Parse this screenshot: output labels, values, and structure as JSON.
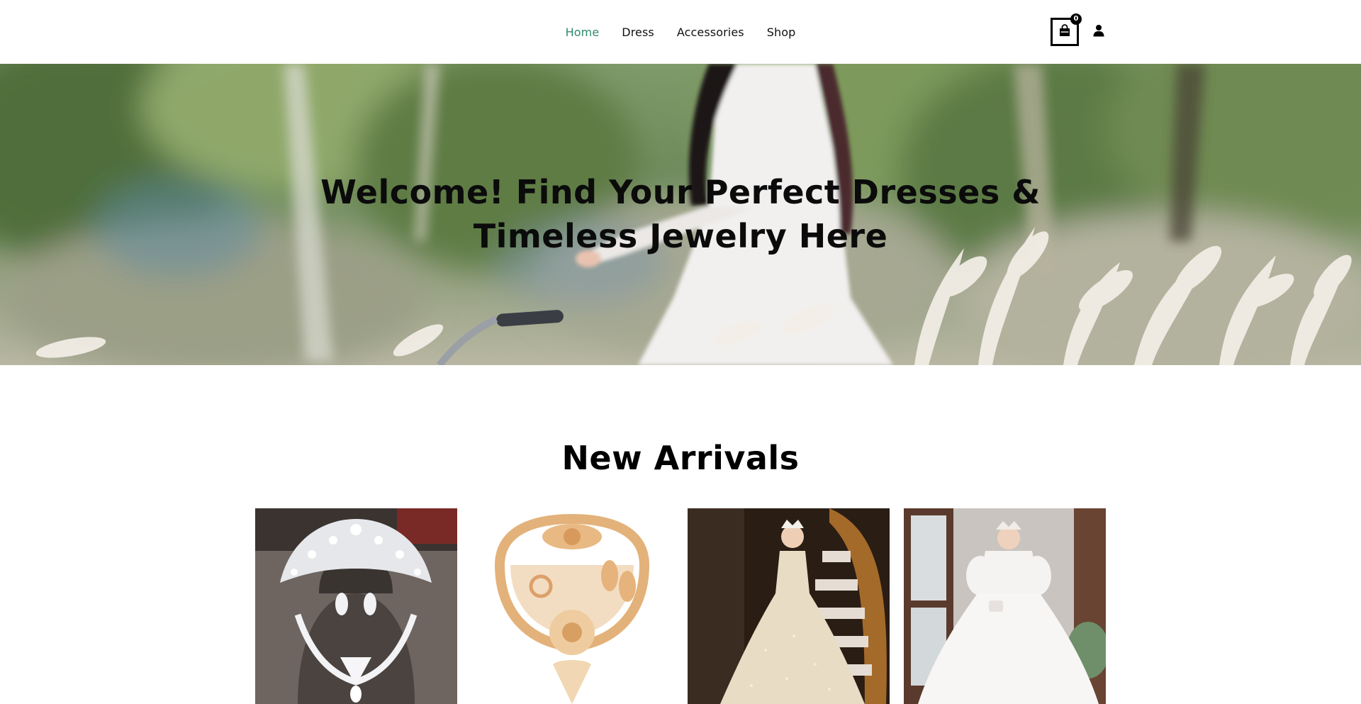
{
  "nav": {
    "items": [
      {
        "label": "Home",
        "active": true
      },
      {
        "label": "Dress",
        "active": false
      },
      {
        "label": "Accessories",
        "active": false
      },
      {
        "label": "Shop",
        "active": false
      }
    ],
    "cart": {
      "icon": "shopping-bag-icon",
      "count": "0"
    },
    "account": {
      "icon": "user-icon"
    }
  },
  "hero": {
    "title": "Welcome! Find Your Perfect Dresses & Timeless Jewelry Here"
  },
  "new_arrivals": {
    "title": "New Arrivals",
    "products": [
      {
        "image": "silver-crystal-tiara-jewelry-set"
      },
      {
        "image": "gold-flower-jewelry-set"
      },
      {
        "image": "champagne-sequin-girls-gown"
      },
      {
        "image": "white-tulle-girls-gown"
      }
    ]
  },
  "colors": {
    "nav_active": "#2e8b6e",
    "text": "#111111",
    "background": "#ffffff"
  }
}
